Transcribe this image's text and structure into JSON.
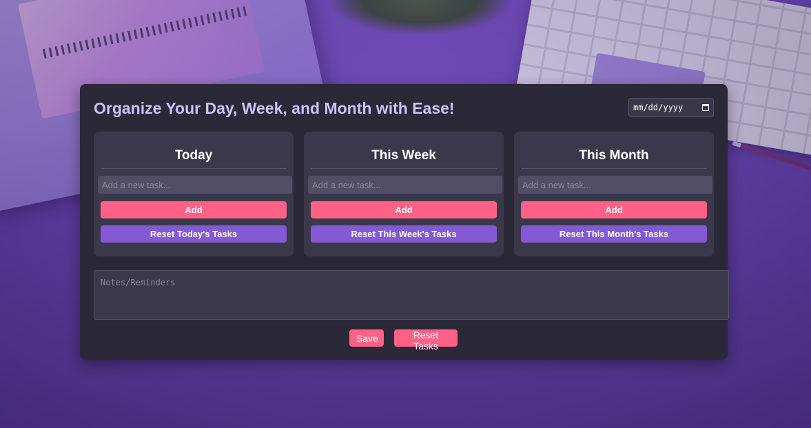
{
  "header": {
    "title": "Organize Your Day, Week, and Month with Ease!",
    "date_placeholder": "mm/dd/yyyy"
  },
  "columns": [
    {
      "title": "Today",
      "input_placeholder": "Add a new task...",
      "add_label": "Add",
      "reset_label": "Reset Today's Tasks"
    },
    {
      "title": "This Week",
      "input_placeholder": "Add a new task...",
      "add_label": "Add",
      "reset_label": "Reset This Week's Tasks"
    },
    {
      "title": "This Month",
      "input_placeholder": "Add a new task...",
      "add_label": "Add",
      "reset_label": "Reset This Month's Tasks"
    }
  ],
  "notes": {
    "placeholder": "Notes/Reminders"
  },
  "footer": {
    "save_label": "Save",
    "reset_label": "Reset Tasks"
  },
  "colors": {
    "panel": "#2b2838",
    "column": "#3b384c",
    "accent_pink": "#ff6286",
    "accent_purple": "#845ad4",
    "title": "#c9c4f5"
  },
  "icons": {
    "date_picker": "calendar-icon"
  }
}
